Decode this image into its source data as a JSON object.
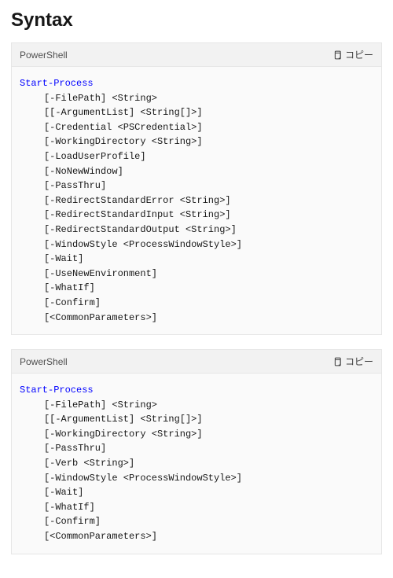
{
  "heading": "Syntax",
  "copy_label": "コピー",
  "blocks": [
    {
      "language": "PowerShell",
      "cmdlet": "Start-Process",
      "params": [
        "[-FilePath] <String>",
        "[[-ArgumentList] <String[]>]",
        "[-Credential <PSCredential>]",
        "[-WorkingDirectory <String>]",
        "[-LoadUserProfile]",
        "[-NoNewWindow]",
        "[-PassThru]",
        "[-RedirectStandardError <String>]",
        "[-RedirectStandardInput <String>]",
        "[-RedirectStandardOutput <String>]",
        "[-WindowStyle <ProcessWindowStyle>]",
        "[-Wait]",
        "[-UseNewEnvironment]",
        "[-WhatIf]",
        "[-Confirm]",
        "[<CommonParameters>]"
      ]
    },
    {
      "language": "PowerShell",
      "cmdlet": "Start-Process",
      "params": [
        "[-FilePath] <String>",
        "[[-ArgumentList] <String[]>]",
        "[-WorkingDirectory <String>]",
        "[-PassThru]",
        "[-Verb <String>]",
        "[-WindowStyle <ProcessWindowStyle>]",
        "[-Wait]",
        "[-WhatIf]",
        "[-Confirm]",
        "[<CommonParameters>]"
      ]
    }
  ]
}
